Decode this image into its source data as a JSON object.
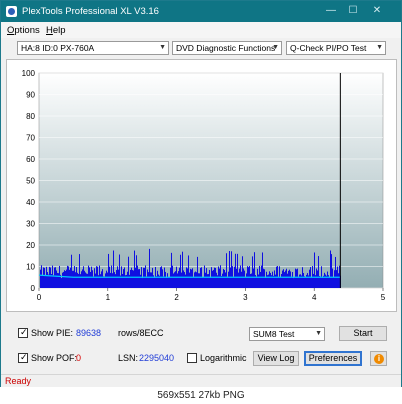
{
  "window": {
    "title": "PlexTools Professional XL V3.16",
    "controls": {
      "minimize": "—",
      "maximize": "☐",
      "close": "✕"
    }
  },
  "menu": {
    "options": {
      "label_first": "O",
      "label_rest": "ptions"
    },
    "help": {
      "label_first": "H",
      "label_rest": "elp"
    }
  },
  "toolbar": {
    "drive": "HA:8 ID:0  PX-760A",
    "function": "DVD Diagnostic Functions",
    "test": "Q-Check PI/PO Test"
  },
  "chart_data": {
    "type": "bar",
    "x_ticks": [
      "0",
      "1",
      "2",
      "3",
      "4",
      "5"
    ],
    "y_ticks": [
      "0",
      "10",
      "20",
      "30",
      "40",
      "50",
      "60",
      "70",
      "80",
      "90",
      "100"
    ],
    "xlim": [
      0,
      5
    ],
    "ylim": [
      0,
      100
    ],
    "scan_end_x": 4.38,
    "series": [
      {
        "color": "#1010e0",
        "kind": "bars",
        "approx_level": 7,
        "typical_max": 14,
        "peak": 19
      },
      {
        "color": "#00c8ff",
        "kind": "line",
        "values_at": [
          [
            0,
            6
          ],
          [
            0.5,
            5
          ],
          [
            1.0,
            5
          ],
          [
            2.0,
            5
          ],
          [
            3.0,
            5
          ],
          [
            4.0,
            5
          ],
          [
            4.38,
            5
          ]
        ]
      }
    ],
    "colors": {
      "plot_bg_top": "#ffffff",
      "plot_bg_bottom": "#93aeb3"
    }
  },
  "bottom": {
    "show_pie_label": "Show PIE:",
    "pie_value": "89638",
    "pie_unit": "rows/8ECC",
    "show_pof_label": "Show POF:",
    "pof_value": "0",
    "lsn_label": "LSN:",
    "lsn_value": "2295040",
    "logarithmic_label": "Logarithmic",
    "sum_select": "SUM8 Test",
    "start_button": "Start",
    "view_log_button": "View Log",
    "preferences_button": "Preferences",
    "show_pie_checked": true,
    "show_pof_checked": true,
    "logarithmic_checked": false
  },
  "status": {
    "text": "Ready",
    "color": "#cc0000"
  },
  "caption": {
    "text": "569x551  27kb  PNG"
  }
}
